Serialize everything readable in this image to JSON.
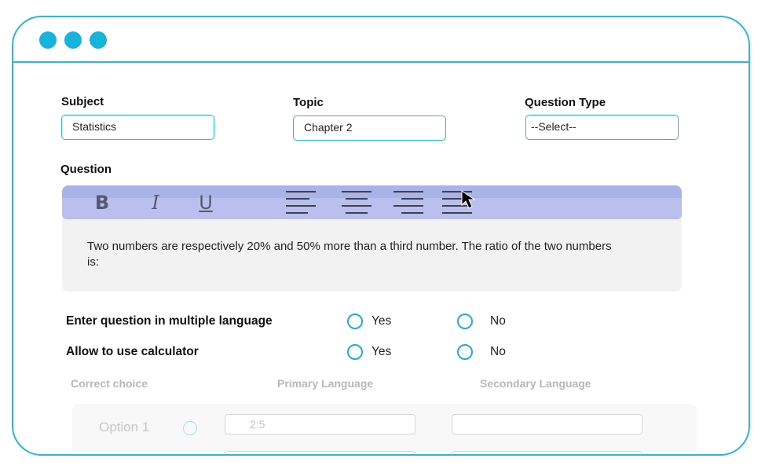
{
  "form": {
    "subject": {
      "label": "Subject",
      "value": "Statistics"
    },
    "topic": {
      "label": "Topic",
      "value": "Chapter 2"
    },
    "question_type": {
      "label": "Question Type",
      "value": "--Select--"
    }
  },
  "question": {
    "label": "Question",
    "toolbar": {
      "bold": "B",
      "italic": "I",
      "underline": "U"
    },
    "text": "Two numbers are respectively 20% and 50% more than a third number. The ratio of the two numbers is:"
  },
  "options": {
    "multi_language": {
      "label": "Enter question in multiple language",
      "yes": "Yes",
      "no": "No"
    },
    "calculator": {
      "label": "Allow to use calculator",
      "yes": "Yes",
      "no": "No"
    }
  },
  "answers": {
    "headers": {
      "correct": "Correct choice",
      "primary": "Primary Language",
      "secondary": "Secondary Language"
    },
    "option1": {
      "label": "Option 1",
      "primary_value": "2:5",
      "secondary_value": ""
    }
  },
  "colors": {
    "accent": "#2bb7d8",
    "dot": "#16b4dd",
    "toolbar": "#aab3e8",
    "editor_bg": "#f2f2f2"
  }
}
